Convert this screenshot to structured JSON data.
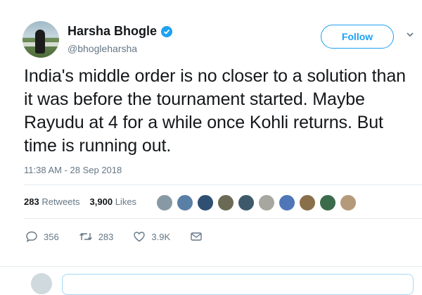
{
  "user": {
    "name": "Harsha Bhogle",
    "handle": "@bhogleharsha",
    "verified": true
  },
  "follow_button": {
    "label": "Follow"
  },
  "tweet": {
    "text": "India's middle order is no closer to a solution than it was before the tournament started. Maybe Rayudu at 4 for a while once Kohli returns. But time is running out.",
    "timestamp": "11:38 AM - 28 Sep 2018"
  },
  "stats": {
    "retweets_count": "283",
    "retweets_label": "Retweets",
    "likes_count": "3,900",
    "likes_label": "Likes"
  },
  "likers": [
    {
      "color": "#8899a6"
    },
    {
      "color": "#5a7fa5"
    },
    {
      "color": "#2f4f73"
    },
    {
      "color": "#6b6b55"
    },
    {
      "color": "#3d5a6b"
    },
    {
      "color": "#a7a7a0"
    },
    {
      "color": "#4f77b8"
    },
    {
      "color": "#8a6f4b"
    },
    {
      "color": "#3b6b4a"
    },
    {
      "color": "#b59a7a"
    }
  ],
  "actions": {
    "replies": "356",
    "retweets": "283",
    "likes": "3.9K"
  },
  "colors": {
    "accent": "#1da1f2",
    "text": "#14171a",
    "muted": "#657786"
  }
}
